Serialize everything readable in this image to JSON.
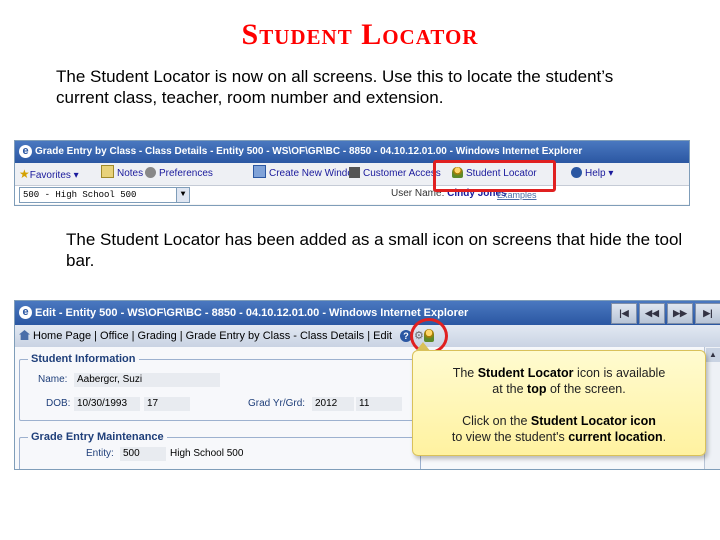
{
  "title": "Student Locator",
  "intro_text": "The Student Locator is now on all screens.  Use this to locate the student’s current class, teacher, room number and extension.",
  "second_text": "The Student Locator has been added as a small icon on screens that hide the tool bar.",
  "screenshot1": {
    "window_title": "Grade Entry by Class - Class Details - Entity 500 - WS\\OF\\GR\\BC - 8850 - 04.10.12.01.00 - Windows Internet Explorer",
    "toolbar": {
      "favorites": "Favorites",
      "notes": "Notes",
      "preferences": "Preferences",
      "create_new_window": "Create New Window",
      "customer_access": "Customer Access",
      "student_locator": "Student Locator",
      "help": "Help"
    },
    "entity_select": "500 - High School 500",
    "user_name_label": "User Name:",
    "user_name": "Cindy Jones",
    "examples_link": "Examples"
  },
  "screenshot2": {
    "window_title": "Edit - Entity 500 - WS\\OF\\GR\\BC - 8850 - 04.10.12.01.00 - Windows Internet Explorer",
    "breadcrumb": "Home Page | Office | Grading | Grade Entry by Class - Class Details | Edit",
    "student_info": {
      "legend": "Student Information",
      "name_label": "Name:",
      "name_value": "Aabergcr, Suzi",
      "dob_label": "DOB:",
      "dob_value": "10/30/1993",
      "age_value": "17",
      "grad_label": "Grad Yr/Grd:",
      "grad_value": "2012",
      "grade_value": "11"
    },
    "grade_entry": {
      "legend": "Grade Entry Maintenance",
      "entity_label": "Entity:",
      "entity_value": "500",
      "entity_name": "High School 500"
    },
    "callout": {
      "l1_pre": "The ",
      "l1_bold": "Student Locator",
      "l1_post": " icon is available",
      "l2_pre": "at the ",
      "l2_bold": "top",
      "l2_post": " of the screen.",
      "l3_pre": "Click on the ",
      "l3_bold": "Student Locator icon",
      "l4_pre": "to view the student's ",
      "l4_bold": "current location",
      "l4_post": "."
    }
  }
}
